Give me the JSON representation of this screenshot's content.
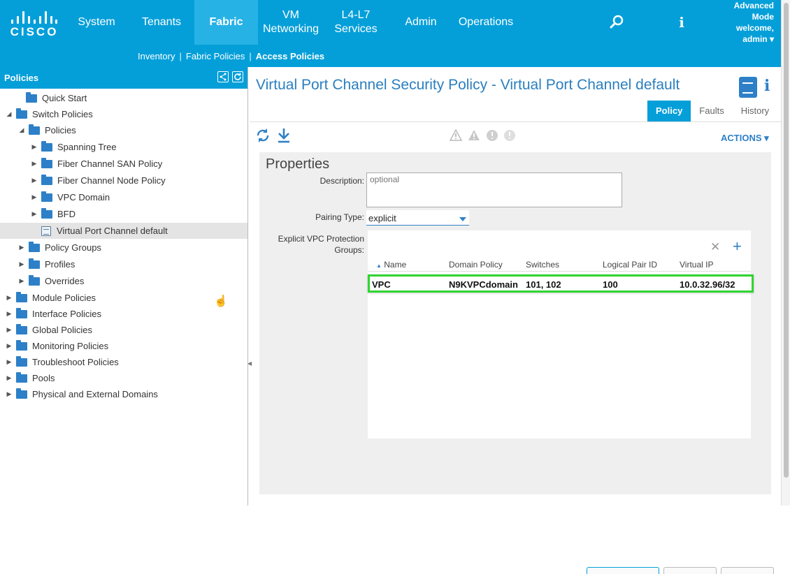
{
  "brand": {
    "logo_text": "CISCO"
  },
  "nav": {
    "items": [
      {
        "label": "System"
      },
      {
        "label": "Tenants"
      },
      {
        "label": "Fabric"
      },
      {
        "label": "VM Networking"
      },
      {
        "label": "L4-L7 Services"
      },
      {
        "label": "Admin"
      },
      {
        "label": "Operations"
      }
    ],
    "active": "Fabric",
    "search_icon": "search-icon",
    "info_icon": "info-icon",
    "info_glyph": "i"
  },
  "user": {
    "mode_line1": "Advanced",
    "mode_line2": "Mode",
    "welcome": "welcome,",
    "username": "admin ▾"
  },
  "subnav": {
    "links": [
      "Inventory",
      "Fabric Policies",
      "Access Policies"
    ],
    "separator": "|"
  },
  "left_panel": {
    "title": "Policies",
    "tree": [
      {
        "label": "Quick Start",
        "caret": "",
        "icon": "folder-icon"
      },
      {
        "label": "Switch Policies",
        "caret": "◢",
        "icon": "folder-icon"
      },
      {
        "label": "Policies",
        "caret": "◢",
        "icon": "folder-icon"
      },
      {
        "label": "Spanning Tree",
        "caret": "▶",
        "icon": "folder-icon"
      },
      {
        "label": "Fiber Channel SAN Policy",
        "caret": "▶",
        "icon": "folder-icon"
      },
      {
        "label": "Fiber Channel Node Policy",
        "caret": "▶",
        "icon": "folder-icon"
      },
      {
        "label": "VPC Domain",
        "caret": "▶",
        "icon": "folder-icon"
      },
      {
        "label": "BFD",
        "caret": "▶",
        "icon": "folder-icon"
      },
      {
        "label": "Virtual Port Channel default",
        "caret": "",
        "icon": "policy-document-icon",
        "selected": true
      },
      {
        "label": "Policy Groups",
        "caret": "▶",
        "icon": "folder-icon"
      },
      {
        "label": "Profiles",
        "caret": "▶",
        "icon": "folder-icon"
      },
      {
        "label": "Overrides",
        "caret": "▶",
        "icon": "folder-icon"
      },
      {
        "label": "Module Policies",
        "caret": "▶",
        "icon": "folder-icon"
      },
      {
        "label": "Interface Policies",
        "caret": "▶",
        "icon": "folder-icon"
      },
      {
        "label": "Global Policies",
        "caret": "▶",
        "icon": "folder-icon"
      },
      {
        "label": "Monitoring Policies",
        "caret": "▶",
        "icon": "folder-icon"
      },
      {
        "label": "Troubleshoot Policies",
        "caret": "▶",
        "icon": "folder-icon"
      },
      {
        "label": "Pools",
        "caret": "▶",
        "icon": "folder-icon"
      },
      {
        "label": "Physical and External Domains",
        "caret": "▶",
        "icon": "folder-icon"
      }
    ]
  },
  "main": {
    "title": "Virtual Port Channel Security Policy - Virtual Port Channel default",
    "tabs": [
      {
        "label": "Policy",
        "active": true
      },
      {
        "label": "Faults"
      },
      {
        "label": "History"
      }
    ],
    "actions_label": "ACTIONS ▾",
    "properties": {
      "heading": "Properties",
      "description_label": "Description:",
      "description_placeholder": "optional",
      "pairing_type_label": "Pairing Type:",
      "pairing_type_value": "explicit",
      "groups_label_line1": "Explicit VPC Protection",
      "groups_label_line2": "Groups:"
    },
    "grid": {
      "columns": [
        "Name",
        "Domain Policy",
        "Switches",
        "Logical Pair ID",
        "Virtual IP"
      ],
      "sort_glyph": "▲",
      "rows": [
        {
          "name": "VPC",
          "domain_policy": "N9KVPCdomain",
          "switches": "101, 102",
          "logical_pair_id": "100",
          "virtual_ip": "10.0.32.96/32"
        }
      ],
      "remove_glyph": "✕",
      "add_glyph": "+"
    }
  },
  "colors": {
    "primary": "#049fd9",
    "link": "#2a7fbf",
    "highlight": "#2fd52f"
  }
}
